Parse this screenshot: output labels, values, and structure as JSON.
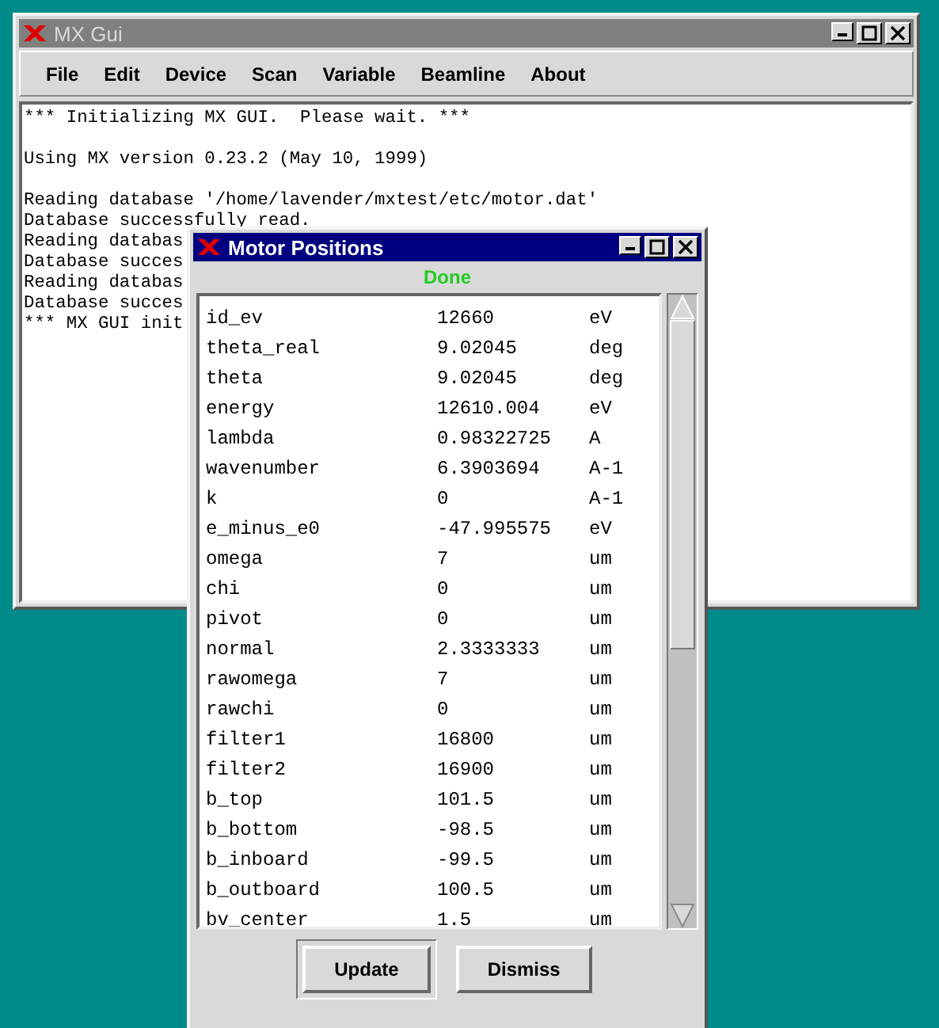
{
  "main_window": {
    "title": "MX Gui",
    "active": false,
    "menu": [
      {
        "label": "File"
      },
      {
        "label": "Edit"
      },
      {
        "label": "Device"
      },
      {
        "label": "Scan"
      },
      {
        "label": "Variable"
      },
      {
        "label": "Beamline"
      },
      {
        "label": "About"
      }
    ],
    "log_paragraphs": [
      [
        "*** Initializing MX GUI.  Please wait. ***"
      ],
      [
        "Using MX version 0.23.2 (May 10, 1999)"
      ],
      [
        "Reading database '/home/lavender/mxtest/etc/motor.dat'",
        "Database successfully read.",
        "Reading databas",
        "Database succes",
        "Reading databas",
        "Database succes",
        "*** MX GUI init"
      ]
    ]
  },
  "motor_window": {
    "title": "Motor Positions",
    "active": true,
    "status": "Done",
    "motors": [
      {
        "name": "id_ev",
        "value": "12660",
        "unit": "eV"
      },
      {
        "name": "theta_real",
        "value": "9.02045",
        "unit": "deg"
      },
      {
        "name": "theta",
        "value": "9.02045",
        "unit": "deg"
      },
      {
        "name": "energy",
        "value": "12610.004",
        "unit": "eV"
      },
      {
        "name": "lambda",
        "value": "0.98322725",
        "unit": "A"
      },
      {
        "name": "wavenumber",
        "value": "6.3903694",
        "unit": "A-1"
      },
      {
        "name": "k",
        "value": "0",
        "unit": "A-1"
      },
      {
        "name": "e_minus_e0",
        "value": "-47.995575",
        "unit": "eV"
      },
      {
        "name": "omega",
        "value": "7",
        "unit": "um"
      },
      {
        "name": "chi",
        "value": "0",
        "unit": "um"
      },
      {
        "name": "pivot",
        "value": "0",
        "unit": "um"
      },
      {
        "name": "normal",
        "value": "2.3333333",
        "unit": "um"
      },
      {
        "name": "rawomega",
        "value": "7",
        "unit": "um"
      },
      {
        "name": "rawchi",
        "value": "0",
        "unit": "um"
      },
      {
        "name": "filter1",
        "value": "16800",
        "unit": "um"
      },
      {
        "name": "filter2",
        "value": "16900",
        "unit": "um"
      },
      {
        "name": "b_top",
        "value": "101.5",
        "unit": "um"
      },
      {
        "name": "b_bottom",
        "value": "-98.5",
        "unit": "um"
      },
      {
        "name": "b_inboard",
        "value": "-99.5",
        "unit": "um"
      },
      {
        "name": "b_outboard",
        "value": "100.5",
        "unit": "um"
      },
      {
        "name": "bv_center",
        "value": "1.5",
        "unit": "um"
      }
    ],
    "buttons": [
      {
        "label": "Update",
        "default": true
      },
      {
        "label": "Dismiss",
        "default": false
      }
    ]
  }
}
